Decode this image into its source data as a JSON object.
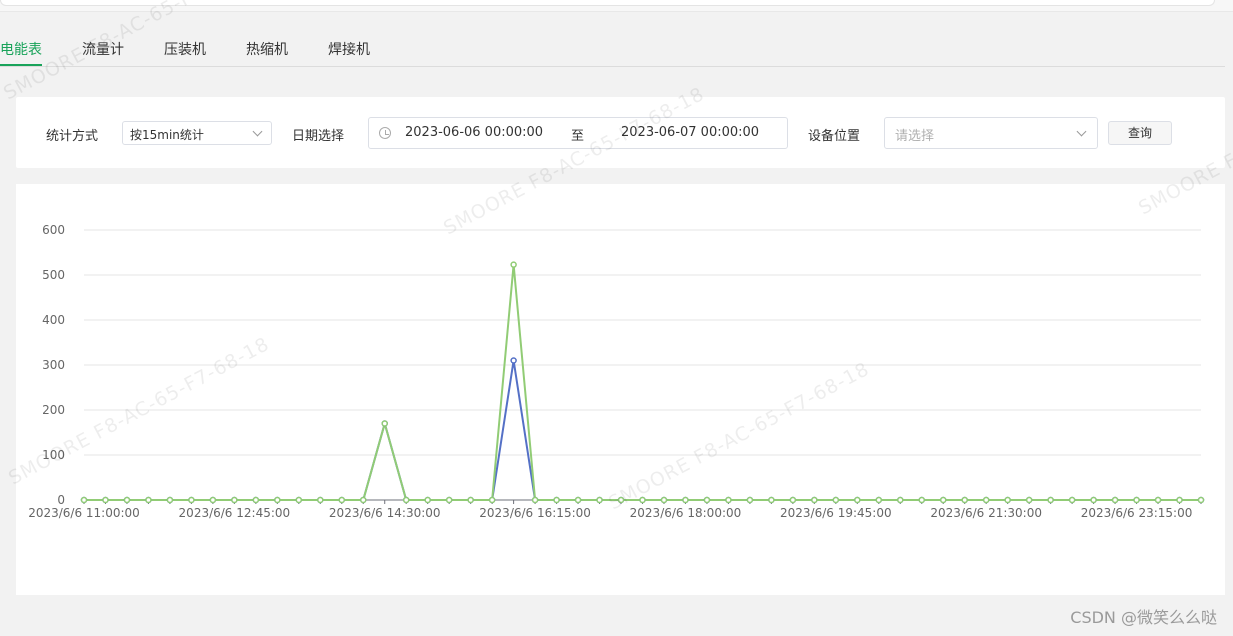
{
  "tabs": [
    {
      "label": "电能表",
      "active": true
    },
    {
      "label": "流量计",
      "active": false
    },
    {
      "label": "压装机",
      "active": false
    },
    {
      "label": "热缩机",
      "active": false
    },
    {
      "label": "焊接机",
      "active": false
    }
  ],
  "filters": {
    "stat_method_label": "统计方式",
    "stat_method_value": "按15min统计",
    "date_label": "日期选择",
    "date_start": "2023-06-06 00:00:00",
    "date_separator": "至",
    "date_end": "2023-06-07 00:00:00",
    "location_label": "设备位置",
    "location_placeholder": "请选择",
    "query_label": "查询"
  },
  "watermark_text": "SMOORE  F8-AC-65-F7-68-18",
  "credit": "CSDN @微笑么么哒",
  "colors": {
    "accent": "#19a35a",
    "series_green": "#91cc75",
    "series_blue": "#5470c6"
  },
  "chart_data": {
    "type": "line",
    "y_ticks": [
      "0",
      "100",
      "200",
      "300",
      "400",
      "500",
      "600"
    ],
    "ylim": [
      0,
      600
    ],
    "x_tick_labels": [
      "2023/6/6 11:00:00",
      "2023/6/6 12:45:00",
      "2023/6/6 14:30:00",
      "2023/6/6 16:15:00",
      "2023/6/6 18:00:00",
      "2023/6/6 19:45:00",
      "2023/6/6 21:30:00",
      "2023/6/6 23:15:00"
    ],
    "x_start": "2023/6/6 11:00:00",
    "x_interval_minutes": 15,
    "point_count": 53,
    "grid": true,
    "series": [
      {
        "color": "#5470c6",
        "values": [
          0,
          0,
          0,
          0,
          0,
          0,
          0,
          0,
          0,
          0,
          0,
          0,
          0,
          0,
          170,
          0,
          0,
          0,
          0,
          0,
          310,
          0,
          0,
          0,
          0,
          0,
          0,
          0,
          0,
          0,
          0,
          0,
          0,
          0,
          0,
          0,
          0,
          0,
          0,
          0,
          0,
          0,
          0,
          0,
          0,
          0,
          0,
          0,
          0,
          0,
          0,
          0,
          0
        ]
      },
      {
        "color": "#91cc75",
        "values": [
          0,
          0,
          0,
          0,
          0,
          0,
          0,
          0,
          0,
          0,
          0,
          0,
          0,
          0,
          170,
          0,
          0,
          0,
          0,
          0,
          523,
          0,
          0,
          0,
          0,
          0,
          0,
          0,
          0,
          0,
          0,
          0,
          0,
          0,
          0,
          0,
          0,
          0,
          0,
          0,
          0,
          0,
          0,
          0,
          0,
          0,
          0,
          0,
          0,
          0,
          0,
          0,
          0
        ]
      }
    ]
  }
}
